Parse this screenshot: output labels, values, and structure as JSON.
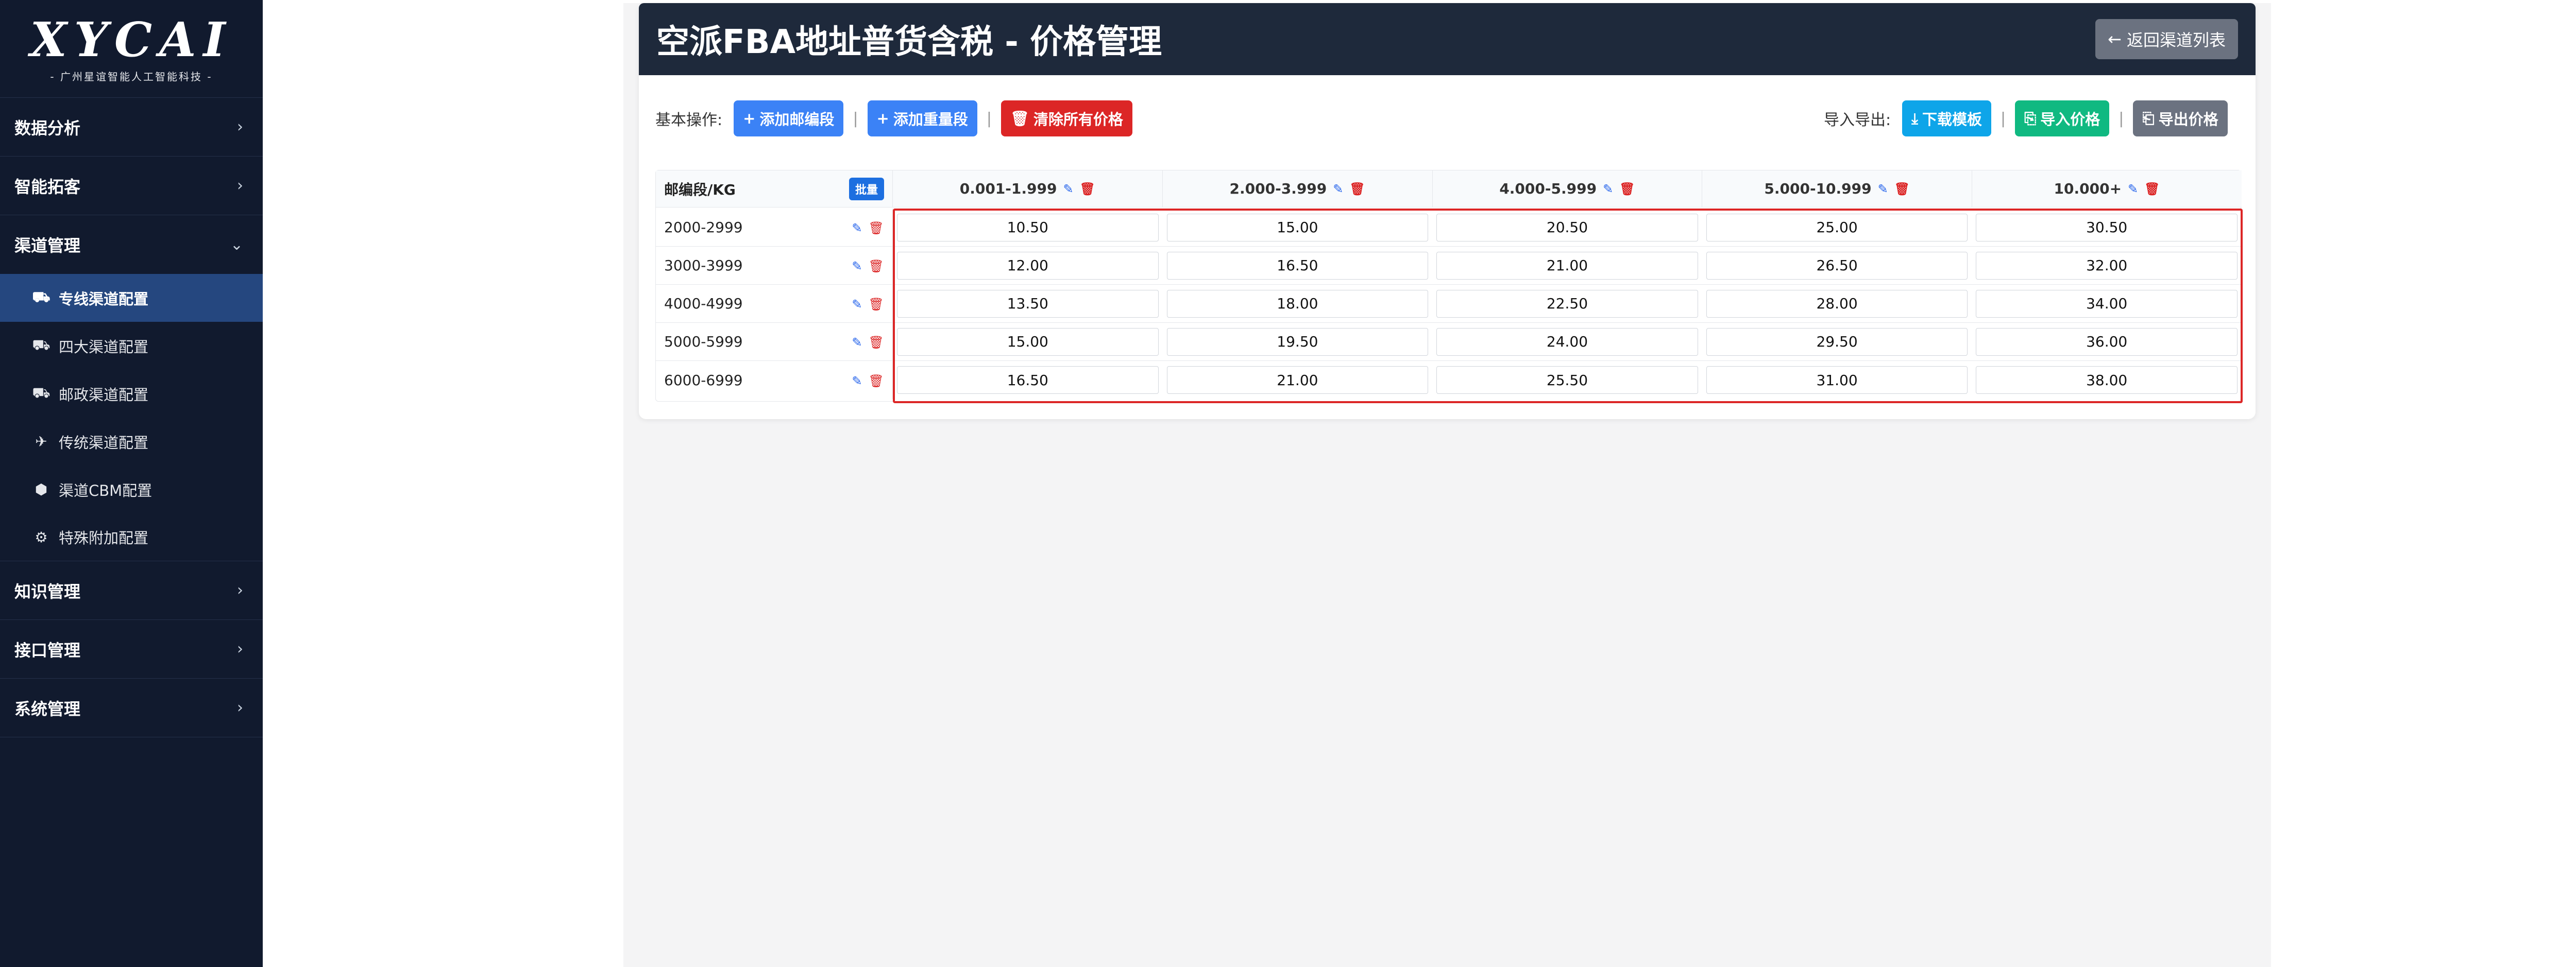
{
  "brand": {
    "logo": "XYCAI",
    "subtitle": "- 广州星谊智能人工智能科技 -"
  },
  "sidebar": {
    "groups": [
      {
        "label": "数据分析"
      },
      {
        "label": "智能拓客"
      },
      {
        "label": "渠道管理",
        "expanded": true,
        "items": [
          {
            "label": "专线渠道配置",
            "icon": "truck-icon",
            "active": true
          },
          {
            "label": "四大渠道配置",
            "icon": "truck-icon"
          },
          {
            "label": "邮政渠道配置",
            "icon": "truck-icon"
          },
          {
            "label": "传统渠道配置",
            "icon": "plane-icon"
          },
          {
            "label": "渠道CBM配置",
            "icon": "cube-icon"
          },
          {
            "label": "特殊附加配置",
            "icon": "gear-icon"
          }
        ]
      },
      {
        "label": "知识管理"
      },
      {
        "label": "接口管理"
      },
      {
        "label": "系统管理"
      }
    ]
  },
  "header": {
    "title": "空派FBA地址普货含税 - 价格管理",
    "back_label": "返回渠道列表"
  },
  "toolbar": {
    "basic_label": "基本操作:",
    "add_zip": "添加邮编段",
    "add_weight": "添加重量段",
    "clear_all": "清除所有价格",
    "io_label": "导入导出:",
    "download_template": "下载模板",
    "import_price": "导入价格",
    "export_price": "导出价格"
  },
  "grid": {
    "corner_label": "邮编段/KG",
    "batch_label": "批量",
    "weights": [
      "0.001-1.999",
      "2.000-3.999",
      "4.000-5.999",
      "5.000-10.999",
      "10.000+"
    ],
    "rows": [
      {
        "zip": "2000-2999",
        "prices": [
          "10.50",
          "15.00",
          "20.50",
          "25.00",
          "30.50"
        ]
      },
      {
        "zip": "3000-3999",
        "prices": [
          "12.00",
          "16.50",
          "21.00",
          "26.50",
          "32.00"
        ]
      },
      {
        "zip": "4000-4999",
        "prices": [
          "13.50",
          "18.00",
          "22.50",
          "28.00",
          "34.00"
        ]
      },
      {
        "zip": "5000-5999",
        "prices": [
          "15.00",
          "19.50",
          "24.00",
          "29.50",
          "36.00"
        ]
      },
      {
        "zip": "6000-6999",
        "prices": [
          "16.50",
          "21.00",
          "25.50",
          "31.00",
          "38.00"
        ]
      }
    ]
  },
  "colors": {
    "sidebar_bg": "#111a2e",
    "active_bg": "#25477f",
    "header_bg": "#1e293b",
    "blue": "#3b82f6",
    "red": "#dc2626",
    "cyan": "#0ea5e9",
    "green": "#10b981",
    "gray": "#6b7280"
  }
}
